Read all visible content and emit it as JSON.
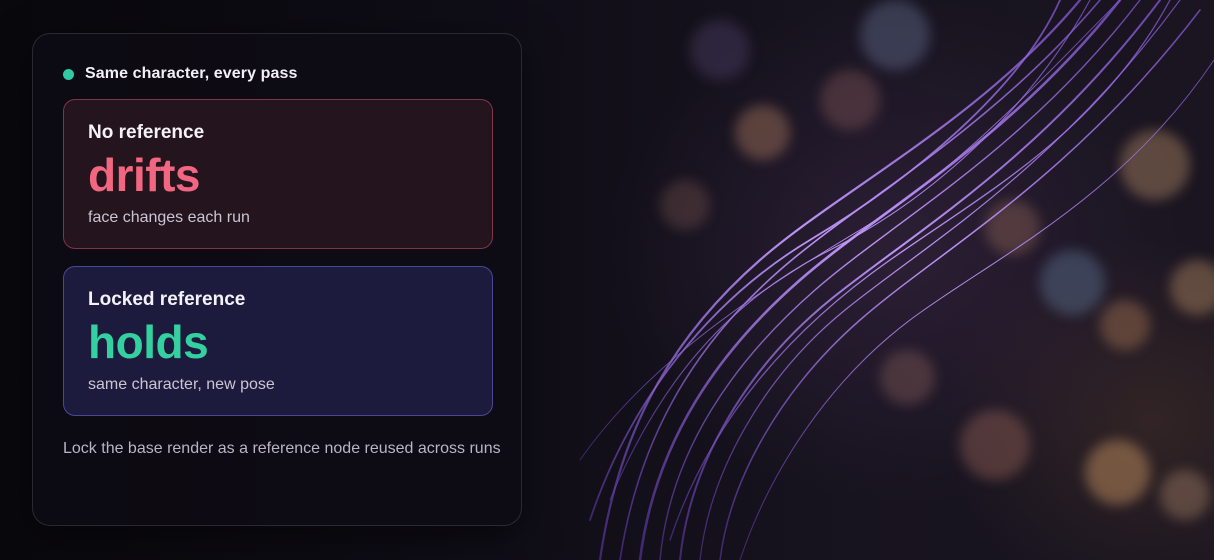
{
  "header": {
    "title": "Same character, every pass",
    "indicator_color": "#2fcaa4"
  },
  "panels": [
    {
      "title": "No reference",
      "headline": "drifts",
      "subtitle": "face changes each run",
      "accent_color": "#f2677f"
    },
    {
      "title": "Locked reference",
      "headline": "holds",
      "subtitle": "same character, new pose",
      "accent_color": "#35d0a0"
    }
  ],
  "footnote": "Lock the base render as a reference node reused across runs",
  "background": {
    "decor": "purple-light-wisps-icon"
  }
}
